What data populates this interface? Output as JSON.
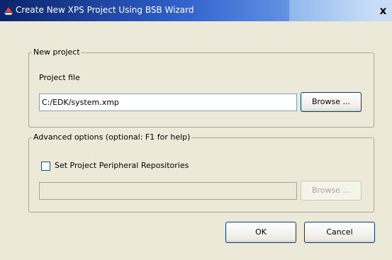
{
  "window": {
    "title": "Create New XPS Project Using BSB Wizard",
    "close_glyph": "x",
    "icon": "app-icon"
  },
  "new_project": {
    "legend": "New project",
    "project_file_label": "Project file",
    "project_file_value": "C:/EDK/system.xmp",
    "browse_label": "Browse ..."
  },
  "advanced": {
    "legend": "Advanced options (optional: F1 for help)",
    "checkbox_label": "Set Project Peripheral Repositories",
    "checkbox_checked": false,
    "repository_value": "",
    "browse_label": "Browse ...",
    "browse_enabled": false
  },
  "footer": {
    "ok_label": "OK",
    "cancel_label": "Cancel"
  },
  "colors": {
    "title_bar_start": "#0A246A",
    "title_bar_end": "#A6CAF0",
    "dialog_background": "#ECE9D8"
  }
}
